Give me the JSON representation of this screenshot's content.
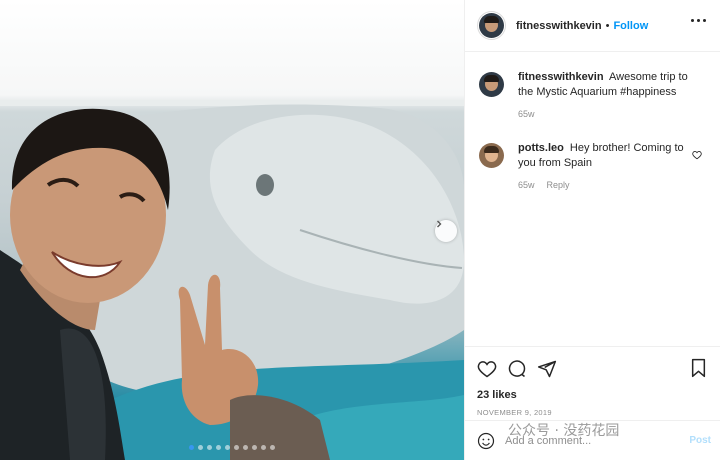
{
  "post": {
    "author": "fitnesswithkevin",
    "separator": "•",
    "follow_label": "Follow",
    "carousel": {
      "total": 10,
      "active_index": 0
    }
  },
  "caption": {
    "username": "fitnesswithkevin",
    "text": "Awesome trip to the Mystic Aquarium #happiness",
    "time": "65w"
  },
  "comments": [
    {
      "username": "potts.leo",
      "text": "Hey brother! Coming to you from Spain",
      "time": "65w",
      "reply_label": "Reply"
    }
  ],
  "actions": {
    "likes": "23 likes",
    "date": "NOVEMBER 9, 2019"
  },
  "add_comment": {
    "placeholder": "Add a comment...",
    "post_label": "Post"
  },
  "watermark": "公众号 · 没药花园",
  "icons": [
    "more-icon",
    "chevron-right-icon",
    "heart-icon",
    "comment-icon",
    "share-icon",
    "bookmark-icon",
    "emoji-icon"
  ],
  "colors": {
    "link_blue": "#0095f6",
    "muted": "#8e8e8e",
    "text": "#262626",
    "divider": "#efefef"
  }
}
